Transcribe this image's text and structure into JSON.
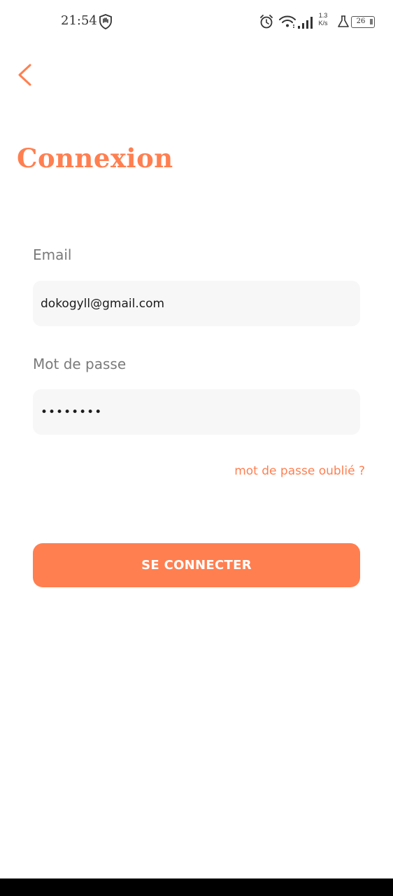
{
  "status_bar": {
    "time": "21:54",
    "network_speed_value": "1.3",
    "network_speed_unit": "K/s",
    "battery_level": "26",
    "icons": [
      "shield-hand-icon",
      "alarm-icon",
      "wifi-icon",
      "signal-icon",
      "flask-icon",
      "battery-icon"
    ]
  },
  "header": {
    "back_icon": "chevron-left-icon",
    "title": "Connexion"
  },
  "form": {
    "email_label": "Email",
    "email_value": "dokogyll@gmail.com",
    "password_label": "Mot de passe",
    "password_value": "••••••••",
    "forgot_password": "mot de passe oublié ?",
    "submit_label": "SE CONNECTER"
  },
  "colors": {
    "accent": "#ff7f50",
    "input_background": "#f7f7f7",
    "label_text": "#7a7a7a"
  }
}
